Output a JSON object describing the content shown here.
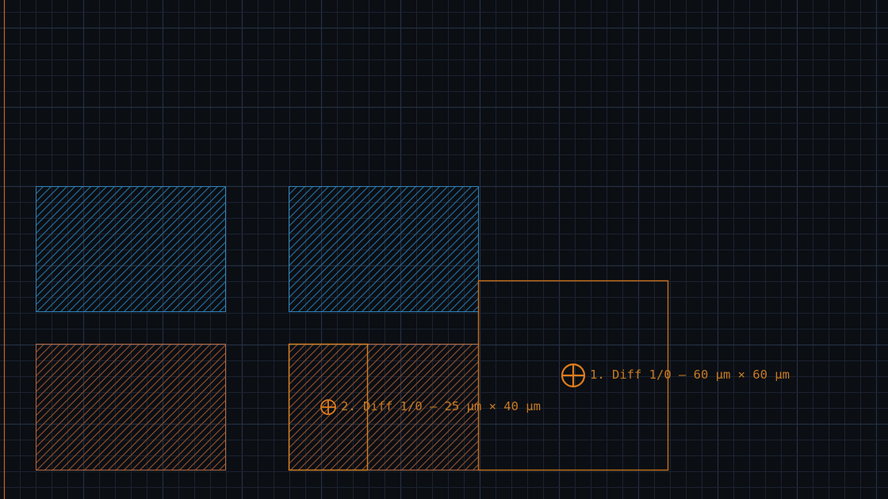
{
  "viewport": {
    "background": "#0b0e13",
    "grid_minor_color": "#1b2330",
    "grid_major_color": "#243042",
    "origin_axis_color": "#c2661e"
  },
  "layers": {
    "blue": {
      "stroke": "#2f82b8",
      "hatch": "#236a98"
    },
    "orange": {
      "stroke": "#b3683e",
      "hatch": "#8a4d2b"
    }
  },
  "annotations": {
    "color": "#e07d1b",
    "text_color": "#c87a22",
    "items": [
      {
        "label": "1. Diff 1/0 — 60 µm × 60 µm"
      },
      {
        "label": "2. Diff 1/0 — 25 µm × 40 µm"
      }
    ]
  }
}
